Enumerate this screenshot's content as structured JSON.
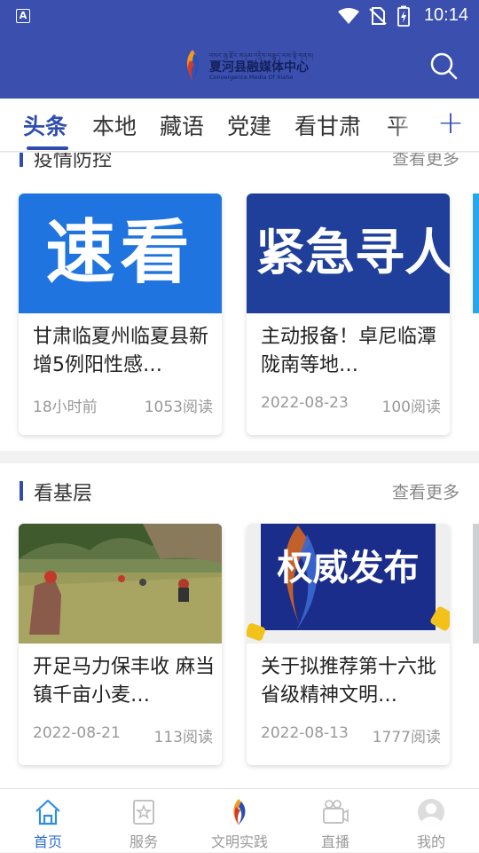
{
  "status_bar": {
    "time": "10:14",
    "left_icon": "A"
  },
  "header": {
    "logo_tibetan": "བསང་ཆུ་རྫོང་མཉམ་འདྲེས་བརྒྱུད་ལམ་ལྟེ་གནས།",
    "logo_cn": "夏河县融媒体中心",
    "logo_en": "Convergence Media Of Xiahe"
  },
  "tabs": [
    {
      "label": "头条",
      "active": true
    },
    {
      "label": "本地"
    },
    {
      "label": "藏语"
    },
    {
      "label": "党建"
    },
    {
      "label": "看甘肃"
    },
    {
      "label": "平"
    }
  ],
  "tab_plus": "+",
  "sections": [
    {
      "title": "疫情防控",
      "more": "查看更多",
      "cards": [
        {
          "thumb_text": "速看",
          "title": "甘肃临夏州临夏县新增5例阳性感…",
          "date": "18小时前",
          "reads": "1053阅读"
        },
        {
          "thumb_text": "紧急寻人",
          "title": "主动报备！卓尼临潭 陇南等地…",
          "date": "2022-08-23",
          "reads": "100阅读"
        }
      ]
    },
    {
      "title": "看基层",
      "more": "查看更多",
      "cards": [
        {
          "title": "开足马力保丰收 麻当镇千亩小麦…",
          "date": "2022-08-21",
          "reads": "113阅读"
        },
        {
          "thumb_text": "权威发布",
          "title": "关于拟推荐第十六批省级精神文明…",
          "date": "2022-08-13",
          "reads": "1777阅读"
        }
      ]
    }
  ],
  "bottom_nav": [
    {
      "label": "首页",
      "icon": "home-icon",
      "active": true
    },
    {
      "label": "服务",
      "icon": "service-icon"
    },
    {
      "label": "文明实践",
      "icon": "civilization-practice-icon"
    },
    {
      "label": "直播",
      "icon": "live-camera-icon"
    },
    {
      "label": "我的",
      "icon": "profile-icon"
    }
  ],
  "colors": {
    "brand_blue": "#3a4fae",
    "accent": "#2f4db0",
    "thumb_blue": "#1f74e0",
    "thumb_navy": "#1f3f9a"
  }
}
